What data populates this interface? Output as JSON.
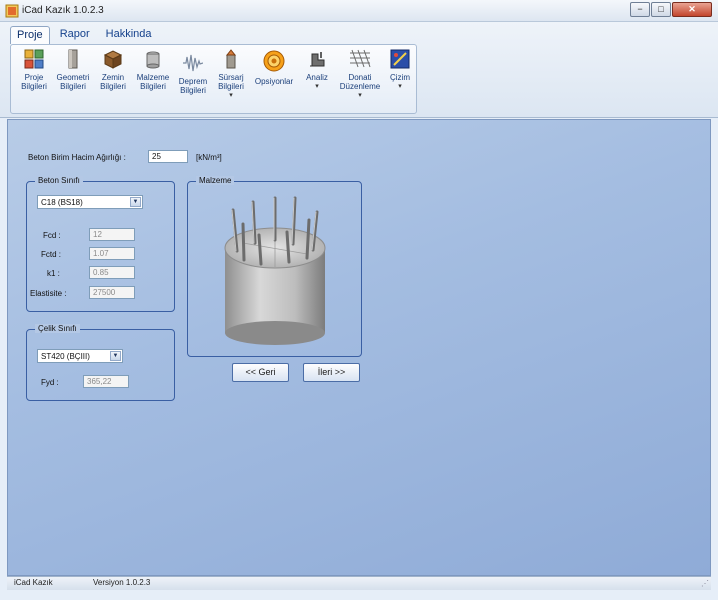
{
  "window": {
    "title": "iCad Kazık 1.0.2.3",
    "min_glyph": "−",
    "max_glyph": "□",
    "close_glyph": "✕"
  },
  "ribbon": {
    "tabs": [
      {
        "label": "Proje"
      },
      {
        "label": "Rapor"
      },
      {
        "label": "Hakkinda"
      }
    ],
    "buttons": [
      {
        "line1": "Proje",
        "line2": "Bilgileri",
        "icon": "project-info-icon"
      },
      {
        "line1": "Geometri",
        "line2": "Bilgileri",
        "icon": "geometry-icon"
      },
      {
        "line1": "Zemin",
        "line2": "Bilgileri",
        "icon": "soil-icon"
      },
      {
        "line1": "Malzeme",
        "line2": "Bilgileri",
        "icon": "material-icon"
      },
      {
        "line1": "Deprem",
        "line2": "Bilgileri",
        "icon": "earthquake-icon"
      },
      {
        "line1": "Sürsarj",
        "line2": "Bilgileri",
        "icon": "surcharge-icon"
      },
      {
        "line1": "Opsiyonlar",
        "line2": "",
        "icon": "options-icon"
      },
      {
        "line1": "Analiz",
        "line2": "",
        "icon": "analysis-icon"
      },
      {
        "line1": "Donati",
        "line2": "Düzenleme",
        "icon": "reinforcement-icon"
      },
      {
        "line1": "Çizim",
        "line2": "",
        "icon": "drawing-icon"
      }
    ]
  },
  "form": {
    "unit_weight_label": "Beton Birim Hacim Ağırlığı :",
    "unit_weight_value": "25",
    "unit_weight_unit": "[kN/m³]",
    "concrete_group": {
      "legend": "Beton Sınıfı",
      "selected": "C18 (BS18)",
      "fcd_label": "Fcd :",
      "fcd_value": "12",
      "fctd_label": "Fctd :",
      "fctd_value": "1.07",
      "k1_label": "k1 :",
      "k1_value": "0.85",
      "elastisite_label": "Elastisite :",
      "elastisite_value": "27500"
    },
    "steel_group": {
      "legend": "Çelik Sınıfı",
      "selected": "ST420 (BÇIII)",
      "fyd_label": "Fyd :",
      "fyd_value": "365,22"
    },
    "material_group": {
      "legend": "Malzeme"
    },
    "back_button": "<< Geri",
    "next_button": "İleri >>"
  },
  "statusbar": {
    "app_name": "iCad Kazık",
    "version": "Versiyon 1.0.2.3"
  }
}
